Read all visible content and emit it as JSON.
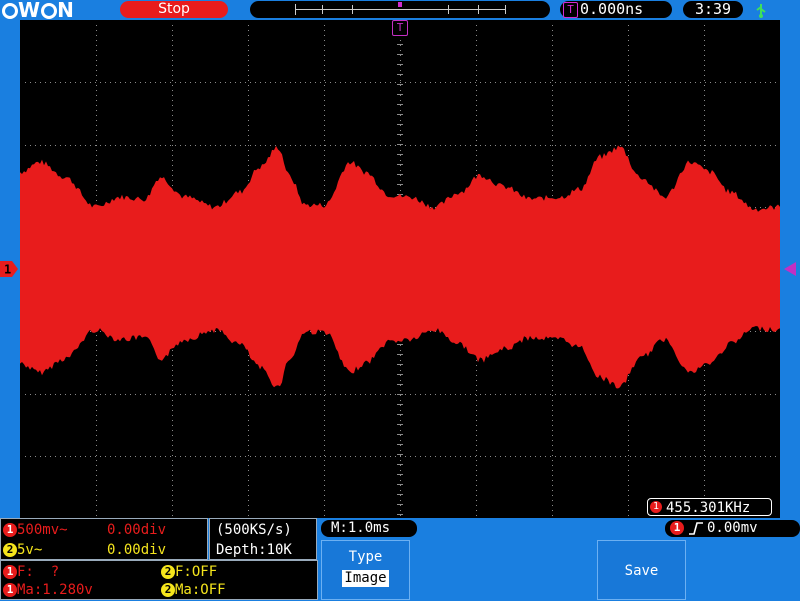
{
  "header": {
    "logo": "OWON",
    "status": "Stop",
    "trigger_position": "0.000ns",
    "clock": "3:39"
  },
  "markers": {
    "trigger": "T",
    "channel1": "1"
  },
  "readouts": {
    "frequency_badge": "1",
    "frequency": "455.301KHz"
  },
  "channels": [
    {
      "badge": "1",
      "scale": "500mv~",
      "offset": "0.00div",
      "color": "#e81c1c"
    },
    {
      "badge": "2",
      "scale": "5v~",
      "offset": "0.00div",
      "color": "#f5e51c"
    }
  ],
  "acquisition": {
    "sample_rate": "(500KS/s)",
    "depth": "Depth:10K"
  },
  "timebase": "M:1.0ms",
  "trigger": {
    "badge": "1",
    "level": "0.00mv"
  },
  "measurements": {
    "ch1_freq": "F:  ?",
    "ch1_max": "Ma:1.280v",
    "ch2_freq": "F:OFF",
    "ch2_max": "Ma:OFF"
  },
  "softkeys": {
    "type_label": "Type",
    "type_value": "Image",
    "save_label": "Save"
  },
  "colors": {
    "background": "#1a7fe0",
    "screen": "#000000",
    "waveform": "#e81c1c",
    "trigger_marker": "#c32fc3"
  }
}
